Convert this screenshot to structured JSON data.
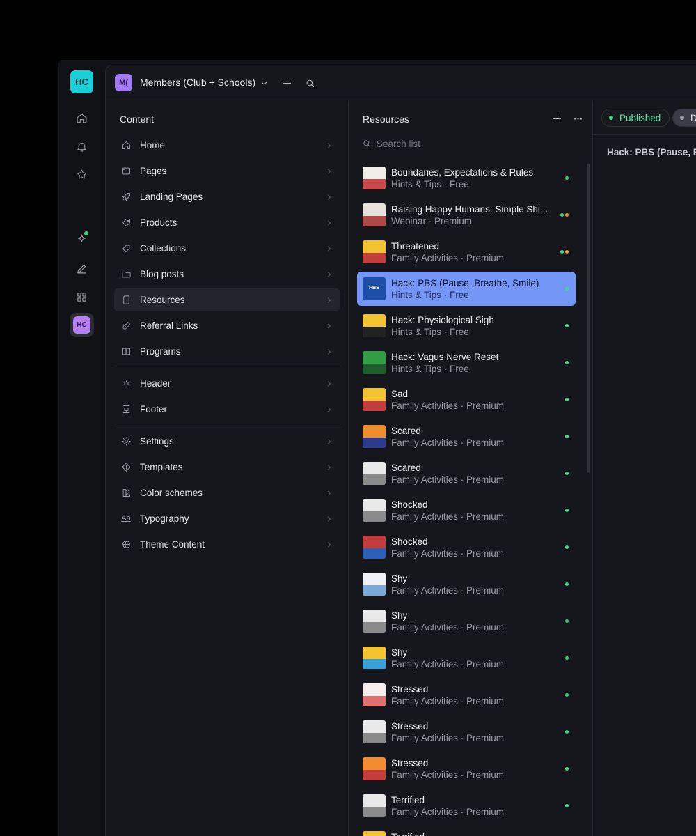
{
  "rail": {
    "logo": "HC",
    "avatar": "HC",
    "icons": [
      "home-icon",
      "bell-icon",
      "star-icon",
      "sparkle-icon",
      "pen-icon",
      "grid-icon"
    ]
  },
  "topbar": {
    "workspace_avatar": "M(",
    "workspace_name": "Members (Club + Schools)"
  },
  "content": {
    "title": "Content",
    "nav": [
      {
        "label": "Home",
        "icon": "home-icon"
      },
      {
        "label": "Pages",
        "icon": "pages-icon"
      },
      {
        "label": "Landing Pages",
        "icon": "rocket-icon"
      },
      {
        "label": "Products",
        "icon": "tag-icon"
      },
      {
        "label": "Collections",
        "icon": "tags-icon"
      },
      {
        "label": "Blog posts",
        "icon": "folder-icon"
      },
      {
        "label": "Resources",
        "icon": "file-icon",
        "active": true
      },
      {
        "label": "Referral Links",
        "icon": "link-icon"
      },
      {
        "label": "Programs",
        "icon": "book-icon"
      },
      {
        "label": "Header",
        "icon": "header-icon"
      },
      {
        "label": "Footer",
        "icon": "footer-icon"
      },
      {
        "label": "Settings",
        "icon": "gear-icon"
      },
      {
        "label": "Templates",
        "icon": "templates-icon"
      },
      {
        "label": "Color schemes",
        "icon": "palette-icon"
      },
      {
        "label": "Typography",
        "icon": "typography-icon"
      },
      {
        "label": "Theme Content",
        "icon": "globe-icon"
      }
    ]
  },
  "resources": {
    "title": "Resources",
    "search_placeholder": "Search list",
    "items": [
      {
        "title": "Boundaries, Expectations & Rules",
        "subtitle": "Hints & Tips · Free",
        "status": [
          "#3ddc84"
        ],
        "thumb": {
          "bg": "#f0ece6",
          "band": "#c84a4a",
          "word": ""
        }
      },
      {
        "title": "Raising Happy Humans: Simple Shi...",
        "subtitle": "Webinar · Premium",
        "status": [
          "#3ddc84",
          "#f5a524"
        ],
        "thumb": {
          "bg": "#e8e2dc",
          "band": "#b04848",
          "word": ""
        }
      },
      {
        "title": "Threatened",
        "subtitle": "Family Activities · Premium",
        "status": [
          "#3ddc84",
          "#f5a524"
        ],
        "thumb": {
          "bg": "#f4c430",
          "band": "#c43d3d",
          "word": ""
        }
      },
      {
        "title": "Hack: PBS (Pause, Breathe, Smile)",
        "subtitle": "Hints & Tips · Free",
        "status": [
          "#3ddc84"
        ],
        "selected": true,
        "thumb": {
          "bg": "#1d4ea8",
          "band": "#1d4ea8",
          "word": "PBS"
        }
      },
      {
        "title": "Hack: Physiological Sigh",
        "subtitle": "Hints & Tips · Free",
        "status": [
          "#3ddc84"
        ],
        "thumb": {
          "bg": "#f4c430",
          "band": "#222222",
          "word": ""
        }
      },
      {
        "title": "Hack: Vagus Nerve Reset",
        "subtitle": "Hints & Tips · Free",
        "status": [
          "#3ddc84"
        ],
        "thumb": {
          "bg": "#2f9e44",
          "band": "#1e5e2a",
          "word": ""
        }
      },
      {
        "title": "Sad",
        "subtitle": "Family Activities · Premium",
        "status": [
          "#3ddc84"
        ],
        "thumb": {
          "bg": "#f4c430",
          "band": "#c43d3d",
          "word": ""
        }
      },
      {
        "title": "Scared",
        "subtitle": "Family Activities · Premium",
        "status": [
          "#3ddc84"
        ],
        "thumb": {
          "bg": "#f08c2e",
          "band": "#2b3a8c",
          "word": ""
        }
      },
      {
        "title": "Scared",
        "subtitle": "Family Activities · Premium",
        "status": [
          "#3ddc84"
        ],
        "thumb": {
          "bg": "#e9e9e9",
          "band": "#8a8a8a",
          "word": ""
        }
      },
      {
        "title": "Shocked",
        "subtitle": "Family Activities · Premium",
        "status": [
          "#3ddc84"
        ],
        "thumb": {
          "bg": "#e9e9e9",
          "band": "#8a8a8a",
          "word": ""
        }
      },
      {
        "title": "Shocked",
        "subtitle": "Family Activities · Premium",
        "status": [
          "#3ddc84"
        ],
        "thumb": {
          "bg": "#c43d3d",
          "band": "#2b5fb8",
          "word": ""
        }
      },
      {
        "title": "Shy",
        "subtitle": "Family Activities · Premium",
        "status": [
          "#3ddc84"
        ],
        "thumb": {
          "bg": "#eef2f6",
          "band": "#7aa8d8",
          "word": ""
        }
      },
      {
        "title": "Shy",
        "subtitle": "Family Activities · Premium",
        "status": [
          "#3ddc84"
        ],
        "thumb": {
          "bg": "#e9e9e9",
          "band": "#8a8a8a",
          "word": ""
        }
      },
      {
        "title": "Shy",
        "subtitle": "Family Activities · Premium",
        "status": [
          "#3ddc84"
        ],
        "thumb": {
          "bg": "#f4c430",
          "band": "#3aa0d8",
          "word": ""
        }
      },
      {
        "title": "Stressed",
        "subtitle": "Family Activities · Premium",
        "status": [
          "#3ddc84"
        ],
        "thumb": {
          "bg": "#f6eeee",
          "band": "#e07070",
          "word": ""
        }
      },
      {
        "title": "Stressed",
        "subtitle": "Family Activities · Premium",
        "status": [
          "#3ddc84"
        ],
        "thumb": {
          "bg": "#e9e9e9",
          "band": "#8a8a8a",
          "word": ""
        }
      },
      {
        "title": "Stressed",
        "subtitle": "Family Activities · Premium",
        "status": [
          "#3ddc84"
        ],
        "thumb": {
          "bg": "#f08c2e",
          "band": "#c43d3d",
          "word": ""
        }
      },
      {
        "title": "Terrified",
        "subtitle": "Family Activities · Premium",
        "status": [
          "#3ddc84"
        ],
        "thumb": {
          "bg": "#e9e9e9",
          "band": "#8a8a8a",
          "word": ""
        }
      },
      {
        "title": "Terrified",
        "subtitle": "",
        "status": [],
        "thumb": {
          "bg": "#f4c430",
          "band": "#c43d3d",
          "word": ""
        }
      }
    ]
  },
  "editor": {
    "status_published": "Published",
    "status_draft": "D",
    "title": "Hack: PBS (Pause, B"
  }
}
